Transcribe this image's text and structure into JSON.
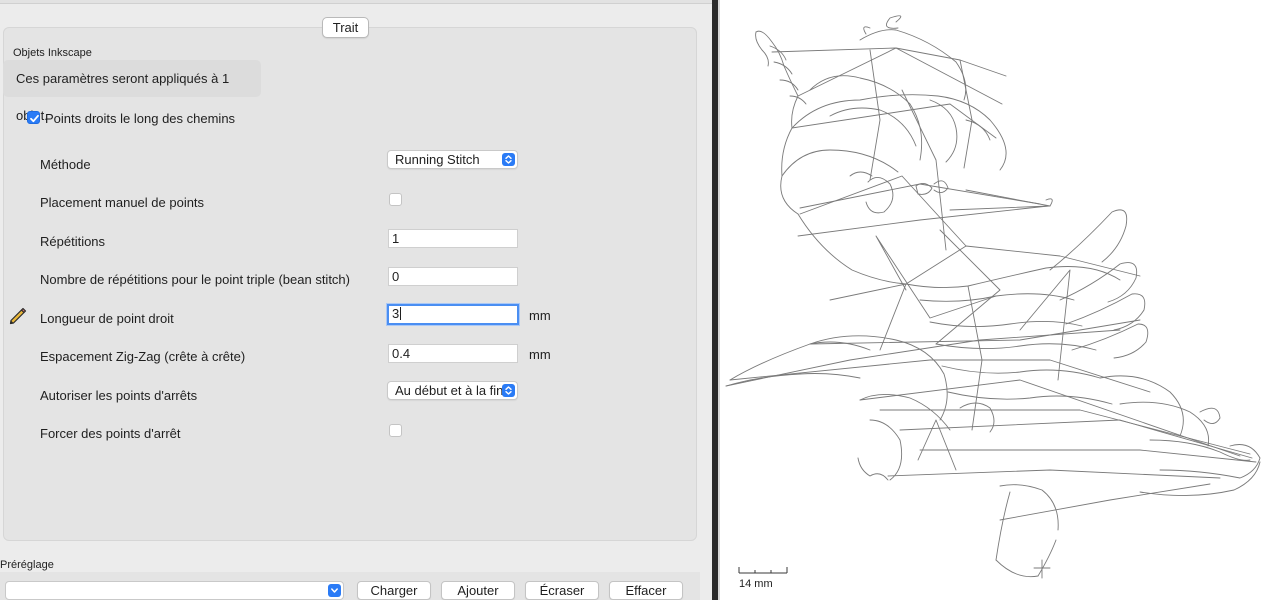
{
  "panel": {
    "tab_title": "Trait",
    "section_label": "Objets Inkscape",
    "info_text": "Ces paramètres seront appliqués à 1 objet.",
    "main_checkbox_label": "Points droits le long des chemins",
    "main_checkbox_checked": true,
    "rows": {
      "methode": {
        "label": "Méthode",
        "value": "Running Stitch"
      },
      "placement": {
        "label": "Placement manuel de points",
        "checked": false
      },
      "repetitions": {
        "label": "Répétitions",
        "value": "1"
      },
      "bean": {
        "label": "Nombre de répétitions pour le point triple (bean stitch)",
        "value": "0"
      },
      "longueur": {
        "label": "Longueur de point droit",
        "value": "3",
        "unit": "mm"
      },
      "espacement": {
        "label": "Espacement Zig-Zag (crête à crête)",
        "value": "0.4",
        "unit": "mm"
      },
      "arrets": {
        "label": "Autoriser les points d'arrêts",
        "value": "Au début et à la fin"
      },
      "forcer": {
        "label": "Forcer des points d'arrêt",
        "checked": false
      }
    }
  },
  "preset": {
    "label": "Préréglage",
    "buttons": {
      "charger": "Charger",
      "ajouter": "Ajouter",
      "ecraser": "Écraser",
      "effacer": "Effacer"
    }
  },
  "canvas": {
    "scale_label": "14 mm"
  },
  "colors": {
    "accent": "#2a7bf6",
    "panel_bg": "#ececec",
    "group_bg": "#e4e4e4",
    "stroke": "#7a7a7a"
  },
  "icons": {
    "edit_indicator": "pencil-icon",
    "select_arrows": "updown-chevron-icon",
    "checkmark": "checkmark-icon"
  }
}
